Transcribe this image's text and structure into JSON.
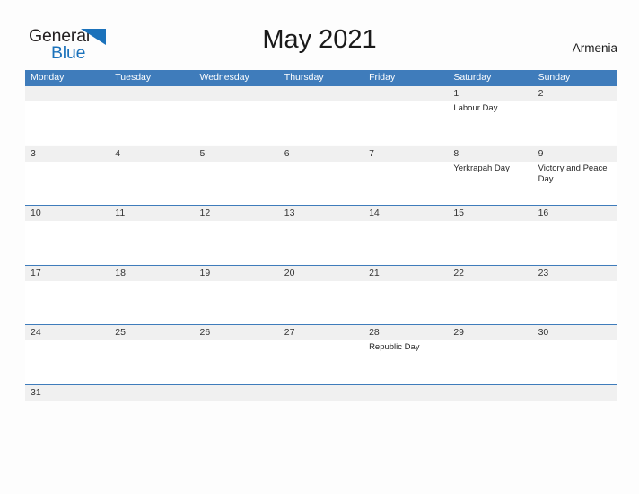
{
  "brand": {
    "word_one": "General",
    "word_two": "Blue",
    "sail_icon": "sail-triangle-icon",
    "accent_color": "#1b72bb"
  },
  "header": {
    "title": "May 2021",
    "country": "Armenia",
    "header_bg": "#3f7cbb",
    "date_band_bg": "#f0f0f0"
  },
  "weekdays": [
    "Monday",
    "Tuesday",
    "Wednesday",
    "Thursday",
    "Friday",
    "Saturday",
    "Sunday"
  ],
  "weeks": [
    {
      "days": [
        {
          "date": "",
          "event": ""
        },
        {
          "date": "",
          "event": ""
        },
        {
          "date": "",
          "event": ""
        },
        {
          "date": "",
          "event": ""
        },
        {
          "date": "",
          "event": ""
        },
        {
          "date": "1",
          "event": "Labour Day"
        },
        {
          "date": "2",
          "event": ""
        }
      ]
    },
    {
      "days": [
        {
          "date": "3",
          "event": ""
        },
        {
          "date": "4",
          "event": ""
        },
        {
          "date": "5",
          "event": ""
        },
        {
          "date": "6",
          "event": ""
        },
        {
          "date": "7",
          "event": ""
        },
        {
          "date": "8",
          "event": "Yerkrapah Day"
        },
        {
          "date": "9",
          "event": "Victory and Peace Day"
        }
      ]
    },
    {
      "days": [
        {
          "date": "10",
          "event": ""
        },
        {
          "date": "11",
          "event": ""
        },
        {
          "date": "12",
          "event": ""
        },
        {
          "date": "13",
          "event": ""
        },
        {
          "date": "14",
          "event": ""
        },
        {
          "date": "15",
          "event": ""
        },
        {
          "date": "16",
          "event": ""
        }
      ]
    },
    {
      "days": [
        {
          "date": "17",
          "event": ""
        },
        {
          "date": "18",
          "event": ""
        },
        {
          "date": "19",
          "event": ""
        },
        {
          "date": "20",
          "event": ""
        },
        {
          "date": "21",
          "event": ""
        },
        {
          "date": "22",
          "event": ""
        },
        {
          "date": "23",
          "event": ""
        }
      ]
    },
    {
      "days": [
        {
          "date": "24",
          "event": ""
        },
        {
          "date": "25",
          "event": ""
        },
        {
          "date": "26",
          "event": ""
        },
        {
          "date": "27",
          "event": ""
        },
        {
          "date": "28",
          "event": "Republic Day"
        },
        {
          "date": "29",
          "event": ""
        },
        {
          "date": "30",
          "event": ""
        }
      ]
    },
    {
      "days": [
        {
          "date": "31",
          "event": ""
        },
        {
          "date": "",
          "event": ""
        },
        {
          "date": "",
          "event": ""
        },
        {
          "date": "",
          "event": ""
        },
        {
          "date": "",
          "event": ""
        },
        {
          "date": "",
          "event": ""
        },
        {
          "date": "",
          "event": ""
        }
      ]
    }
  ]
}
